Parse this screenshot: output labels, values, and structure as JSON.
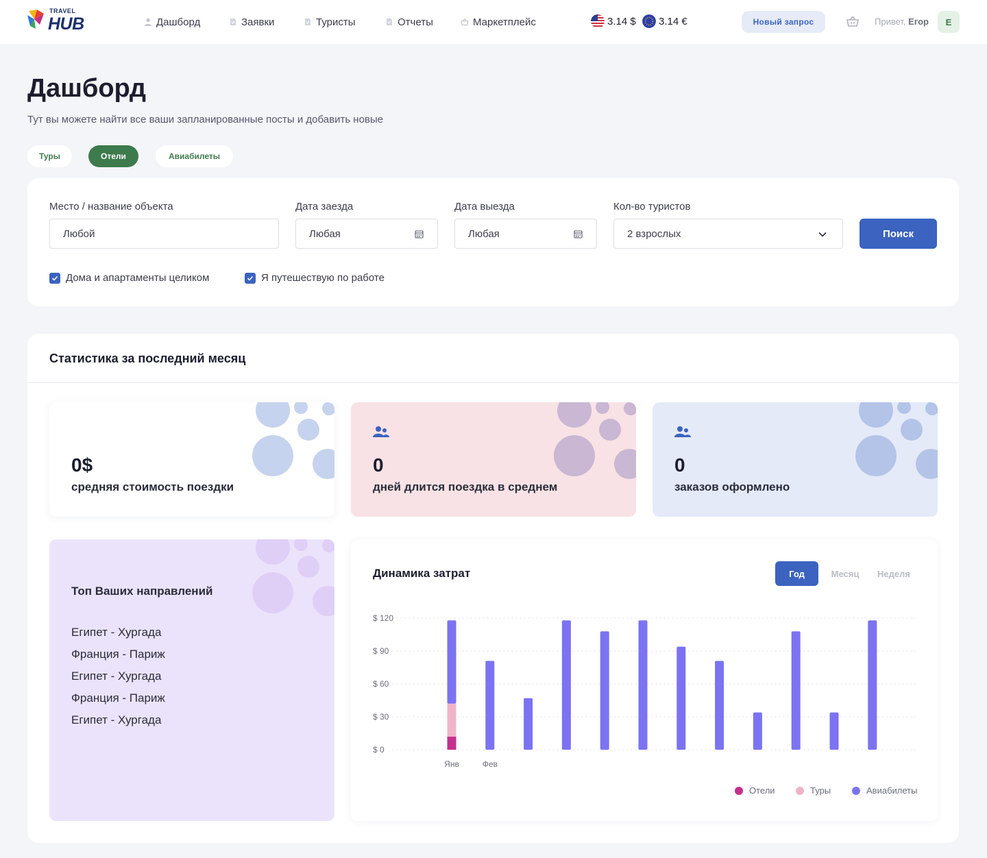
{
  "header": {
    "logo_small": "TRAVEL",
    "logo_big": "HUB",
    "nav": [
      {
        "label": "Дашборд",
        "icon": "user-icon"
      },
      {
        "label": "Заявки",
        "icon": "document-icon"
      },
      {
        "label": "Туристы",
        "icon": "document-icon"
      },
      {
        "label": "Отчеты",
        "icon": "document-icon"
      },
      {
        "label": "Маркетплейс",
        "icon": "basket-icon"
      }
    ],
    "currency_usd": "3.14 $",
    "currency_eur": "3.14 €",
    "new_request": "Новый запрос",
    "greeting_prefix": "Привет,",
    "user_name": "Егор",
    "avatar_letter": "Е"
  },
  "page": {
    "title": "Дашборд",
    "subtitle": "Тут вы можете найти все ваши запланированные посты и добавить новые",
    "tabs": [
      "Туры",
      "Отели",
      "Авиабилеты"
    ],
    "active_tab": "Отели"
  },
  "search": {
    "place_label": "Место / название объекта",
    "place_value": "Любой",
    "checkin_label": "Дата заезда",
    "checkin_value": "Любая",
    "checkout_label": "Дата выезда",
    "checkout_value": "Любая",
    "tourists_label": "Кол-во туристов",
    "tourists_value": "2 взрослых",
    "button": "Поиск",
    "checkbox_homes": "Дома и апартаменты целиком",
    "checkbox_business": "Я путешествую по работе"
  },
  "stats": {
    "title": "Статистика за последний месяц",
    "avg_cost_value": "0$",
    "avg_cost_label": "средняя стоимость поездки",
    "days_value": "0",
    "days_label": "дней длится поездка в среднем",
    "orders_value": "0",
    "orders_label": "заказов оформлено",
    "top_title": "Топ Ваших направлений",
    "destinations": [
      "Египет - Хургада",
      "Франция - Париж",
      "Египет - Хургада",
      "Франция - Париж",
      "Египет - Хургада"
    ]
  },
  "chart": {
    "title": "Динамика затрат",
    "tabs": [
      "Год",
      "Месяц",
      "Неделя"
    ],
    "active_tab": "Год",
    "legend": [
      "Отели",
      "Туры",
      "Авиабилеты"
    ]
  },
  "colors": {
    "primary": "#3b63bf",
    "green": "#3d7a4c",
    "hotels": "#c4308d",
    "tours": "#f0b4c9",
    "flights": "#7b73f2"
  },
  "chart_data": {
    "type": "bar",
    "stacked": true,
    "categories": [
      "Янв",
      "Фев",
      "",
      "",
      "",
      "",
      "",
      "",
      "",
      "",
      "",
      ""
    ],
    "y_tick_labels": [
      "$ 0",
      "$ 30",
      "$ 60",
      "$ 90",
      "$ 120"
    ],
    "ylim": [
      0,
      120
    ],
    "grid": true,
    "legend_position": "bottom-right",
    "series": [
      {
        "name": "Отели",
        "values": [
          12,
          0,
          0,
          0,
          0,
          0,
          0,
          0,
          0,
          0,
          0,
          0
        ]
      },
      {
        "name": "Туры",
        "values": [
          30,
          0,
          0,
          0,
          0,
          0,
          0,
          0,
          0,
          0,
          0,
          0
        ]
      },
      {
        "name": "Авиабилеты",
        "values": [
          76,
          81,
          47,
          118,
          108,
          118,
          94,
          81,
          34,
          108,
          34,
          118
        ]
      }
    ]
  }
}
